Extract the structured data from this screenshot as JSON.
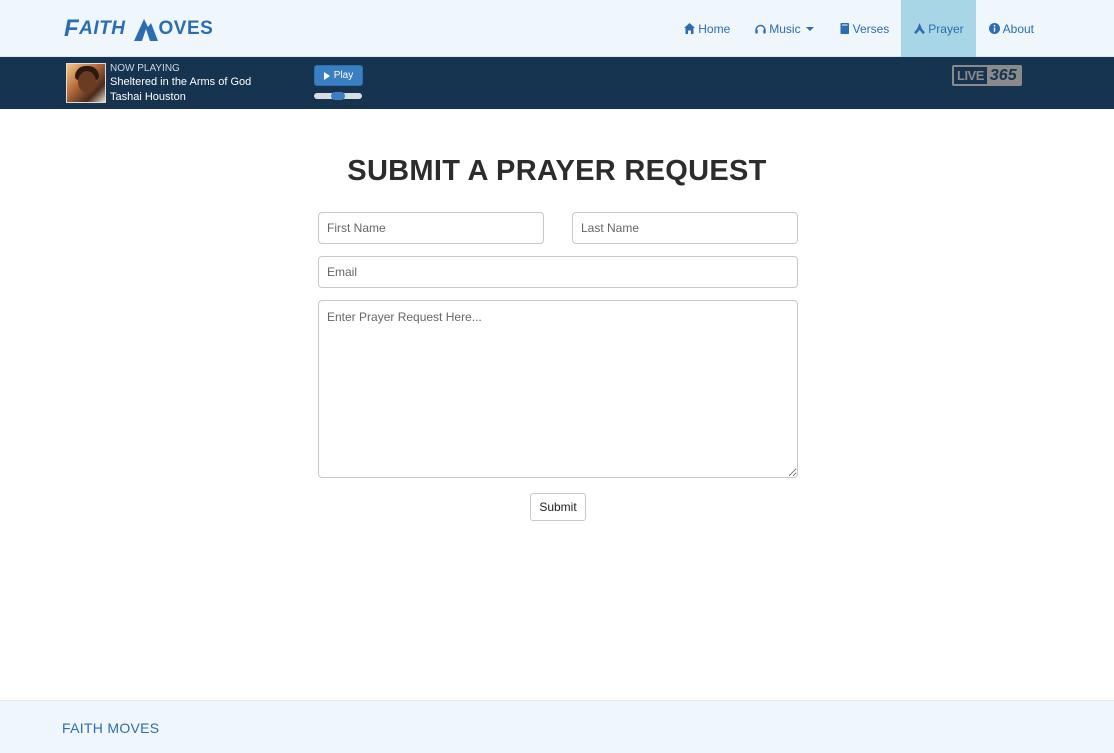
{
  "brand": {
    "logo_text_first": "FAITH",
    "logo_text_second": "OVES",
    "brand_color": "#2b6db0"
  },
  "nav": {
    "items": [
      {
        "label": "Home",
        "icon": "home-icon"
      },
      {
        "label": "Music",
        "icon": "headphones-icon",
        "dropdown": true
      },
      {
        "label": "Verses",
        "icon": "book-icon"
      },
      {
        "label": "Prayer",
        "icon": "praying-hands-icon",
        "active": true
      },
      {
        "label": "About",
        "icon": "info-circle-icon"
      }
    ],
    "active_bg": "#a9d6e6"
  },
  "player": {
    "label": "NOW PLAYING",
    "title": "Sheltered in the Arms of God",
    "artist": "Tashai Houston",
    "play_label": "Play",
    "volume": 0.5,
    "provider_left": "LIVE",
    "provider_right": "365",
    "bar_color": "#16334f"
  },
  "main": {
    "title": "SUBMIT A PRAYER REQUEST",
    "first_name_placeholder": "First Name",
    "last_name_placeholder": "Last Name",
    "email_placeholder": "Email",
    "request_placeholder": "Enter Prayer Request Here...",
    "submit_label": "Submit"
  },
  "footer": {
    "text": "FAITH MOVES"
  }
}
